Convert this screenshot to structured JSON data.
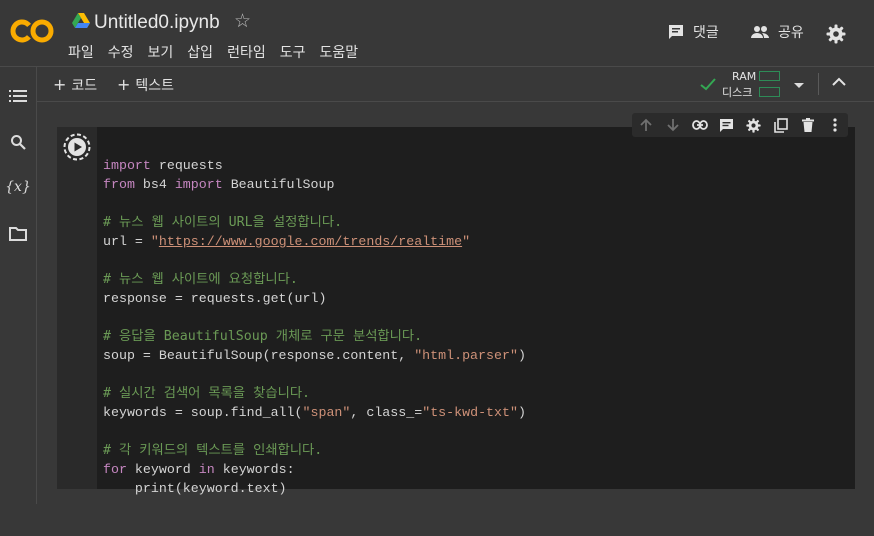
{
  "header": {
    "logo_text": "CO",
    "title": "Untitled0.ipynb",
    "menu": [
      "파일",
      "수정",
      "보기",
      "삽입",
      "런타임",
      "도구",
      "도움말"
    ],
    "comment_label": "댓글",
    "share_label": "공유"
  },
  "toolbar": {
    "add_code_label": "코드",
    "add_text_label": "텍스트",
    "ram_label": "RAM",
    "disk_label": "디스크"
  },
  "colors": {
    "accent_orange": "#f9ab00",
    "check_green": "#34a853",
    "keyword": "#c586c0",
    "string": "#ce9178",
    "comment": "#6a9955"
  },
  "icons": {
    "sidebar": [
      "toc-icon",
      "search-icon",
      "variables-icon",
      "folder-icon"
    ],
    "cell_toolbar": [
      "arrow-up-icon",
      "arrow-down-icon",
      "link-icon",
      "comment-icon",
      "gear-icon",
      "mirror-cell-icon",
      "trash-icon",
      "more-vert-icon"
    ]
  },
  "code": {
    "l1_kw": "import",
    "l1_rest": " requests",
    "l2_kw1": "from",
    "l2_mid": " bs4 ",
    "l2_kw2": "import",
    "l2_rest": " BeautifulSoup",
    "l4_comment": "# 뉴스 웹 사이트의 URL을 설정합니다.",
    "l5_pre": "url = ",
    "l5_q1": "\"",
    "l5_url": "https://www.google.com/trends/realtime",
    "l5_q2": "\"",
    "l7_comment": "# 뉴스 웹 사이트에 요청합니다.",
    "l8": "response = requests.get(url)",
    "l10_comment": "# 응답을 BeautifulSoup 개체로 구문 분석합니다.",
    "l11_pre": "soup = BeautifulSoup(response.content, ",
    "l11_str": "\"html.parser\"",
    "l11_post": ")",
    "l13_comment": "# 실시간 검색어 목록을 찾습니다.",
    "l14_pre": "keywords = soup.find_all(",
    "l14_str1": "\"span\"",
    "l14_mid": ", class_=",
    "l14_str2": "\"ts-kwd-txt\"",
    "l14_post": ")",
    "l16_comment": "# 각 키워드의 텍스트를 인쇄합니다.",
    "l17_kw1": "for",
    "l17_mid": " keyword ",
    "l17_kw2": "in",
    "l17_rest": " keywords:",
    "l18": "    print(keyword.text)"
  }
}
